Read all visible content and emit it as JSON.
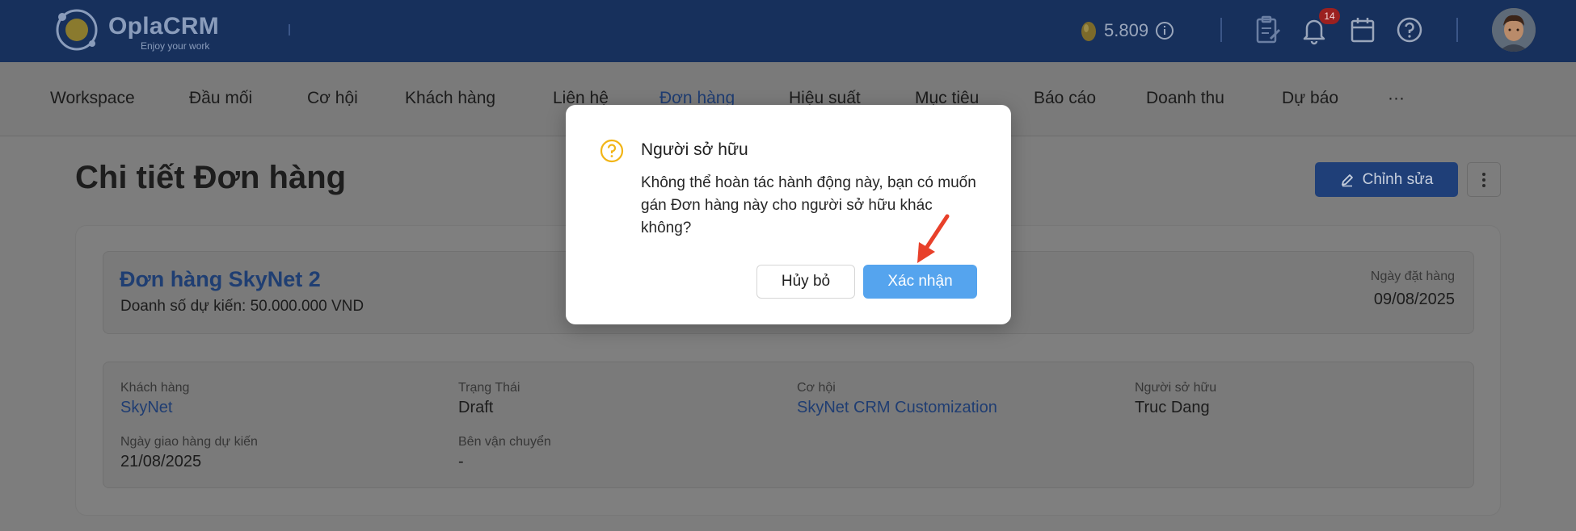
{
  "app": {
    "logo_text": "OplaCRM",
    "logo_tagline": "Enjoy your work",
    "coins": "5.809",
    "notification_count": "14"
  },
  "nav": {
    "items": [
      "Workspace",
      "Đầu mối",
      "Cơ hội",
      "Khách hàng",
      "Liên hệ",
      "Đơn hàng",
      "Hiệu suất",
      "Mục tiêu",
      "Báo cáo",
      "Doanh thu",
      "Dự báo",
      "···"
    ],
    "active": "Đơn hàng"
  },
  "page": {
    "title": "Chi tiết Đơn hàng",
    "edit_label": "Chỉnh sửa"
  },
  "order": {
    "name": "Đơn hàng SkyNet 2",
    "expected_sales": "Doanh số dự kiến: 50.000.000 VND",
    "order_date_label": "Ngày đặt hàng",
    "order_date": "09/08/2025"
  },
  "details": {
    "customer_label": "Khách hàng",
    "customer": "SkyNet",
    "status_label": "Trạng Thái",
    "status": "Draft",
    "opportunity_label": "Cơ hội",
    "opportunity": "SkyNet CRM Customization",
    "owner_label": "Người sở hữu",
    "owner": "Truc Dang",
    "delivery_label": "Ngày giao hàng dự kiến",
    "delivery": "21/08/2025",
    "shipper_label": "Bên vận chuyển",
    "shipper": "-"
  },
  "modal": {
    "title": "Người sở hữu",
    "message": "Không thể hoàn tác hành động này, bạn có muốn gán Đơn hàng này cho người sở hữu khác không?",
    "cancel_label": "Hủy bỏ",
    "confirm_label": "Xác nhận"
  },
  "colors": {
    "topbar": "#17305c",
    "link": "#1f3d72",
    "confirm_button": "#55a4ee",
    "annotation_arrow": "#e8402a",
    "question_icon": "#f2b517"
  },
  "icons": [
    "logo-icon",
    "coin-icon",
    "info-icon",
    "clipboard-icon",
    "bell-icon",
    "calendar-icon",
    "help-icon",
    "avatar",
    "pencil-icon",
    "more-vertical-icon",
    "question-icon",
    "annotation-arrow"
  ]
}
